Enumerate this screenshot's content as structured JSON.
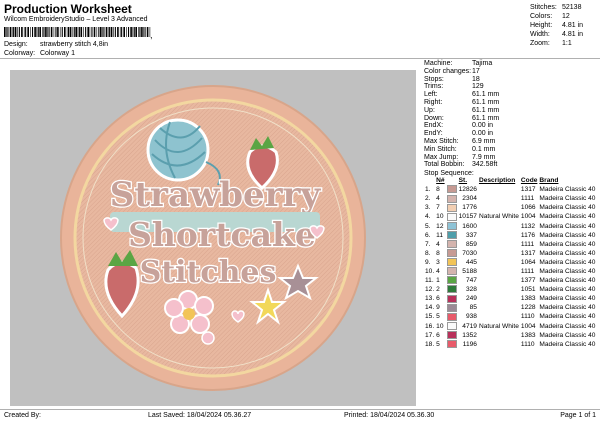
{
  "header": {
    "title": "Production Worksheet",
    "subtitle": "Wilcom EmbroideryStudio – Level 3 Advanced"
  },
  "design": {
    "label": "Design:",
    "value": "strawberry stitch 4,8in"
  },
  "colorway": {
    "label": "Colorway:",
    "value": "Colorway 1"
  },
  "top_stats": [
    {
      "label": "Stitches:",
      "value": "52138"
    },
    {
      "label": "Colors:",
      "value": "12"
    },
    {
      "label": "Height:",
      "value": "4.81 in"
    },
    {
      "label": "Width:",
      "value": "4.81 in"
    },
    {
      "label": "Zoom:",
      "value": "1:1"
    }
  ],
  "machine_info": [
    {
      "label": "Machine:",
      "value": "Tajima"
    },
    {
      "label": "Color changes:",
      "value": "17"
    },
    {
      "label": "Stops:",
      "value": "18"
    },
    {
      "label": "Trims:",
      "value": "129"
    },
    {
      "label": "Left:",
      "value": "61.1 mm"
    },
    {
      "label": "Right:",
      "value": "61.1 mm"
    },
    {
      "label": "Up:",
      "value": "61.1 mm"
    },
    {
      "label": "Down:",
      "value": "61.1 mm"
    },
    {
      "label": "EndX:",
      "value": "0.00 in"
    },
    {
      "label": "EndY:",
      "value": "0.00 in"
    },
    {
      "label": "Max Stitch:",
      "value": "6.9 mm"
    },
    {
      "label": "Min Stitch:",
      "value": "0.1 mm"
    },
    {
      "label": "Max Jump:",
      "value": "7.9 mm"
    },
    {
      "label": "Total Bobbin:",
      "value": "342.58ft"
    }
  ],
  "stop_sequence": {
    "title": "Stop Sequence:",
    "columns": [
      "N#",
      "St.",
      "Description",
      "Code",
      "Brand"
    ],
    "rows": [
      {
        "stop": "1.",
        "needle": "8",
        "color": "#c69a93",
        "stitches": "12826",
        "desc": "",
        "code": "1317",
        "brand": "Madeira Classic 40"
      },
      {
        "stop": "2.",
        "needle": "4",
        "color": "#d4b4ae",
        "stitches": "2304",
        "desc": "",
        "code": "1111",
        "brand": "Madeira Classic 40"
      },
      {
        "stop": "3.",
        "needle": "7",
        "color": "#f2cfb3",
        "stitches": "1776",
        "desc": "",
        "code": "1066",
        "brand": "Madeira Classic 40"
      },
      {
        "stop": "4.",
        "needle": "10",
        "color": "#fafafa",
        "stitches": "10157",
        "desc": "Natural White",
        "code": "1004",
        "brand": "Madeira Classic 40"
      },
      {
        "stop": "5.",
        "needle": "12",
        "color": "#8ec3d6",
        "stitches": "1600",
        "desc": "",
        "code": "1132",
        "brand": "Madeira Classic 40"
      },
      {
        "stop": "6.",
        "needle": "11",
        "color": "#4e9eaa",
        "stitches": "337",
        "desc": "",
        "code": "1176",
        "brand": "Madeira Classic 40"
      },
      {
        "stop": "7.",
        "needle": "4",
        "color": "#d4b4ae",
        "stitches": "859",
        "desc": "",
        "code": "1111",
        "brand": "Madeira Classic 40"
      },
      {
        "stop": "8.",
        "needle": "8",
        "color": "#c69a93",
        "stitches": "7030",
        "desc": "",
        "code": "1317",
        "brand": "Madeira Classic 40"
      },
      {
        "stop": "9.",
        "needle": "3",
        "color": "#f2c457",
        "stitches": "445",
        "desc": "",
        "code": "1064",
        "brand": "Madeira Classic 40"
      },
      {
        "stop": "10.",
        "needle": "4",
        "color": "#d4b4ae",
        "stitches": "5188",
        "desc": "",
        "code": "1111",
        "brand": "Madeira Classic 40"
      },
      {
        "stop": "11.",
        "needle": "1",
        "color": "#5aa544",
        "stitches": "747",
        "desc": "",
        "code": "1377",
        "brand": "Madeira Classic 40"
      },
      {
        "stop": "12.",
        "needle": "2",
        "color": "#2e7a3a",
        "stitches": "328",
        "desc": "",
        "code": "1051",
        "brand": "Madeira Classic 40"
      },
      {
        "stop": "13.",
        "needle": "6",
        "color": "#b8305a",
        "stitches": "249",
        "desc": "",
        "code": "1383",
        "brand": "Madeira Classic 40"
      },
      {
        "stop": "14.",
        "needle": "9",
        "color": "#9c8a96",
        "stitches": "85",
        "desc": "",
        "code": "1228",
        "brand": "Madeira Classic 40"
      },
      {
        "stop": "15.",
        "needle": "5",
        "color": "#e85a6a",
        "stitches": "938",
        "desc": "",
        "code": "1110",
        "brand": "Madeira Classic 40"
      },
      {
        "stop": "16.",
        "needle": "10",
        "color": "#fafafa",
        "stitches": "4719",
        "desc": "Natural White",
        "code": "1004",
        "brand": "Madeira Classic 40"
      },
      {
        "stop": "17.",
        "needle": "6",
        "color": "#b8305a",
        "stitches": "1352",
        "desc": "",
        "code": "1383",
        "brand": "Madeira Classic 40"
      },
      {
        "stop": "18.",
        "needle": "5",
        "color": "#e85a6a",
        "stitches": "1196",
        "desc": "",
        "code": "1110",
        "brand": "Madeira Classic 40"
      }
    ]
  },
  "footer": {
    "created_by": "Created By:",
    "last_saved": "Last Saved: 18/04/2024 05.36.27",
    "printed": "Printed: 18/04/2024 05.36.30",
    "page": "Page 1 of 1"
  },
  "artwork": {
    "line1": "Strawberry",
    "line2": "Shortcake",
    "line3": "Stitches"
  }
}
